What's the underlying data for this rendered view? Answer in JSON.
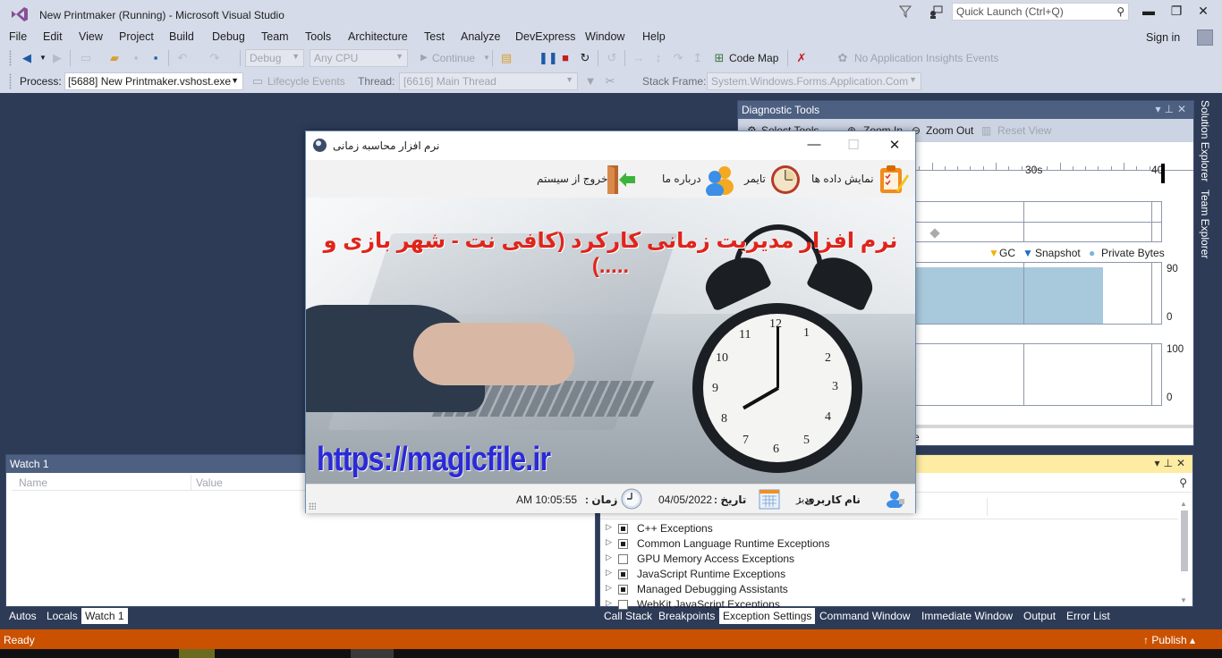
{
  "window": {
    "title": "New Printmaker (Running) - Microsoft Visual Studio",
    "quick_launch_placeholder": "Quick Launch (Ctrl+Q)",
    "sign_in": "Sign in"
  },
  "menu": [
    "File",
    "Edit",
    "View",
    "Project",
    "Build",
    "Debug",
    "Team",
    "Tools",
    "Architecture",
    "Test",
    "Analyze",
    "DevExpress",
    "Window",
    "Help"
  ],
  "toolbar": {
    "config": "Debug",
    "platform": "Any CPU",
    "continue": "Continue",
    "code_map": "Code Map",
    "insights": "No Application Insights Events",
    "process_label": "Process:",
    "process_value": "[5688] New Printmaker.vshost.exe",
    "lifecycle": "Lifecycle Events",
    "thread_label": "Thread:",
    "thread_value": "[6616] Main Thread",
    "stack_frame_label": "Stack Frame:",
    "stack_frame_value": "System.Windows.Forms.Application.Com"
  },
  "diagnostic": {
    "title": "Diagnostic Tools",
    "select_tools": "Select Tools",
    "zoom_in": "Zoom In",
    "zoom_out": "Zoom Out",
    "reset_view": "Reset View",
    "timeline_labels": [
      "30s",
      "40"
    ],
    "legend": [
      "GC",
      "Snapshot",
      "Private Bytes"
    ],
    "memory_axis": {
      "max": "90",
      "min": "0"
    },
    "cpu_axis": {
      "max": "100",
      "min": "0"
    },
    "memory_fill_fraction": 0.86,
    "bottom_text": "e"
  },
  "side_tabs": [
    "Solution Explorer",
    "Team Explorer"
  ],
  "watch": {
    "title": "Watch 1",
    "col_name": "Name",
    "col_value": "Value",
    "tabs": [
      "Autos",
      "Locals",
      "Watch 1"
    ],
    "active_tab": "Watch 1"
  },
  "exceptions": {
    "rows": [
      {
        "label": "C++ Exceptions",
        "checked": true
      },
      {
        "label": "Common Language Runtime Exceptions",
        "checked": true
      },
      {
        "label": "GPU Memory Access Exceptions",
        "checked": false
      },
      {
        "label": "JavaScript Runtime Exceptions",
        "checked": true
      },
      {
        "label": "Managed Debugging Assistants",
        "checked": true
      },
      {
        "label": "WebKit JavaScript Exceptions",
        "checked": false
      }
    ],
    "tabs": [
      "Call Stack",
      "Breakpoints",
      "Exception Settings",
      "Command Window",
      "Immediate Window",
      "Output",
      "Error List"
    ],
    "active_tab": "Exception Settings"
  },
  "status": {
    "ready": "Ready",
    "publish": "Publish"
  },
  "app": {
    "title": "نرم افزار محاسبه زمانی",
    "menu": {
      "show_data": "نمایش داده ها",
      "timer": "تایمر",
      "about": "درباره ما",
      "exit": "خروج از سیستم"
    },
    "banner_title": "نرم افزار مدیریت زمانی کارکرد (کافی نت - شهر بازی و .....)",
    "banner_url": "https://magicfile.ir",
    "status": {
      "user_label": "نام کاربری :",
      "user_value": "مدیر",
      "date_label": "تاریخ :",
      "date_value": "04/05/2022",
      "time_label": "زمان :",
      "time_value": "AM 10:05:55"
    }
  }
}
